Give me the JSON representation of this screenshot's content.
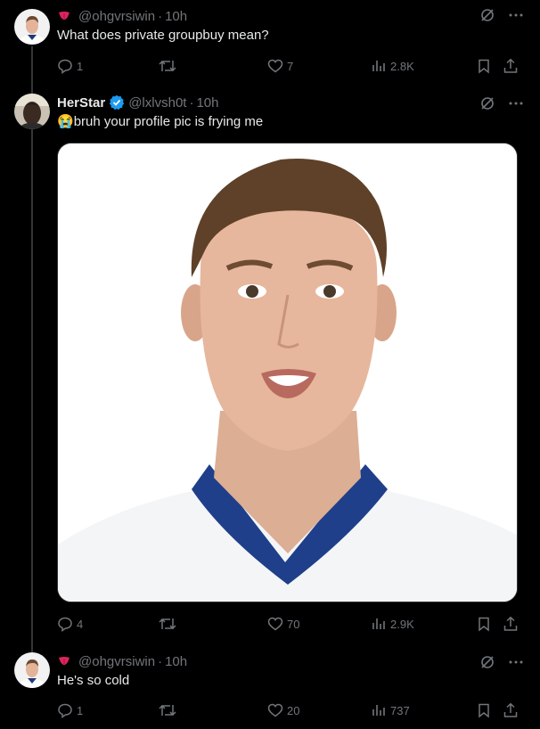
{
  "tweets": [
    {
      "name": "",
      "handle": "@ohgvrsiwin",
      "time": "10h",
      "text": "What does private groupbuy mean?",
      "replies": "1",
      "retweets": "",
      "likes": "7",
      "views": "2.8K"
    },
    {
      "name": "HerStar",
      "handle": "@lxlvsh0t",
      "time": "10h",
      "emoji": "😭",
      "text": "bruh your profile pic is frying me",
      "replies": "4",
      "retweets": "",
      "likes": "70",
      "views": "2.9K"
    },
    {
      "name": "",
      "handle": "@ohgvrsiwin",
      "time": "10h",
      "text": "He's so cold",
      "replies": "1",
      "retweets": "",
      "likes": "20",
      "views": "737"
    }
  ],
  "separator": "·",
  "colors": {
    "bg": "#000000",
    "text": "#e7e9ea",
    "muted": "#71767b",
    "verified": "#1d9bf0",
    "line": "#333639"
  },
  "icons": [
    "reply-icon",
    "retweet-icon",
    "like-icon",
    "views-icon",
    "bookmark-icon",
    "share-icon",
    "grok-icon",
    "more-icon",
    "verified-badge-icon",
    "tongue-emoji-icon"
  ]
}
